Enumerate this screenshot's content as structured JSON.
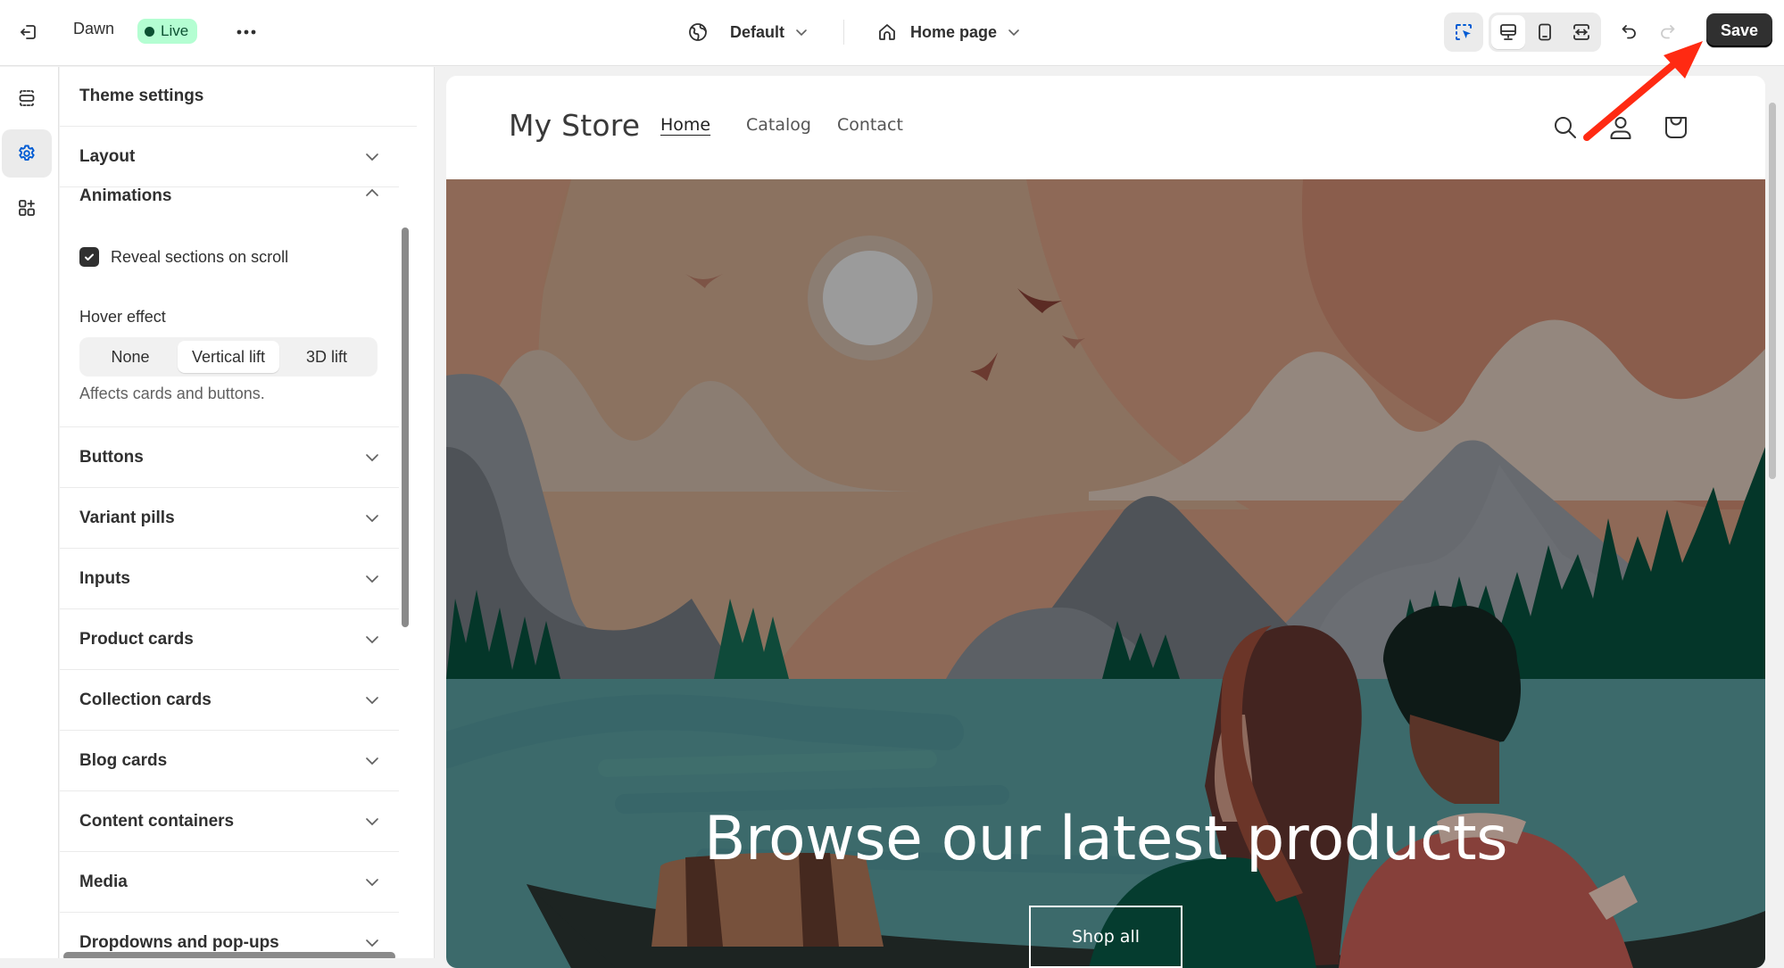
{
  "topbar": {
    "exit_icon": "exit-icon",
    "theme_name": "Dawn",
    "status_badge": "Live",
    "more_label": "•••",
    "locale": {
      "icon": "globe-icon",
      "label": "Default"
    },
    "page": {
      "icon": "home-icon",
      "label": "Home page"
    },
    "inspector_icon": "select-inspector-icon",
    "viewports": [
      {
        "name": "desktop",
        "icon": "desktop-icon",
        "active": true
      },
      {
        "name": "mobile",
        "icon": "mobile-icon",
        "active": false
      },
      {
        "name": "full-width",
        "icon": "full-width-icon",
        "active": false
      }
    ],
    "undo_icon": "undo-icon",
    "redo_icon": "redo-icon",
    "save_label": "Save"
  },
  "rail": {
    "items": [
      {
        "name": "sections",
        "icon": "sections-icon",
        "active": false
      },
      {
        "name": "theme-settings",
        "icon": "gear-icon",
        "active": true
      },
      {
        "name": "apps",
        "icon": "apps-icon",
        "active": false
      }
    ]
  },
  "panel": {
    "title": "Theme settings",
    "sections_before": [
      {
        "label": "Layout",
        "expanded": false
      }
    ],
    "animations": {
      "label": "Animations",
      "expanded": true,
      "reveal_on_scroll": {
        "label": "Reveal sections on scroll",
        "checked": true
      },
      "hover_effect": {
        "label": "Hover effect",
        "options": [
          "None",
          "Vertical lift",
          "3D lift"
        ],
        "selected": "Vertical lift",
        "help": "Affects cards and buttons."
      }
    },
    "sections_after": [
      {
        "label": "Buttons"
      },
      {
        "label": "Variant pills"
      },
      {
        "label": "Inputs"
      },
      {
        "label": "Product cards"
      },
      {
        "label": "Collection cards"
      },
      {
        "label": "Blog cards"
      },
      {
        "label": "Content containers"
      },
      {
        "label": "Media"
      },
      {
        "label": "Dropdowns and pop-ups"
      }
    ]
  },
  "preview": {
    "store_name": "My Store",
    "nav": [
      {
        "label": "Home",
        "active": true
      },
      {
        "label": "Catalog",
        "active": false
      },
      {
        "label": "Contact",
        "active": false
      }
    ],
    "header_icons": [
      "search-icon",
      "account-icon",
      "cart-icon"
    ],
    "hero": {
      "heading": "Browse our latest products",
      "button_label": "Shop all"
    }
  },
  "colors": {
    "live_badge_bg": "#b4fed2",
    "live_badge_text": "#0c5132",
    "save_bg": "#303030",
    "accent_blue": "#005bd3",
    "annotation_red": "#ff2a12",
    "sky": "#8b7260",
    "water": "#3c6a6b"
  }
}
